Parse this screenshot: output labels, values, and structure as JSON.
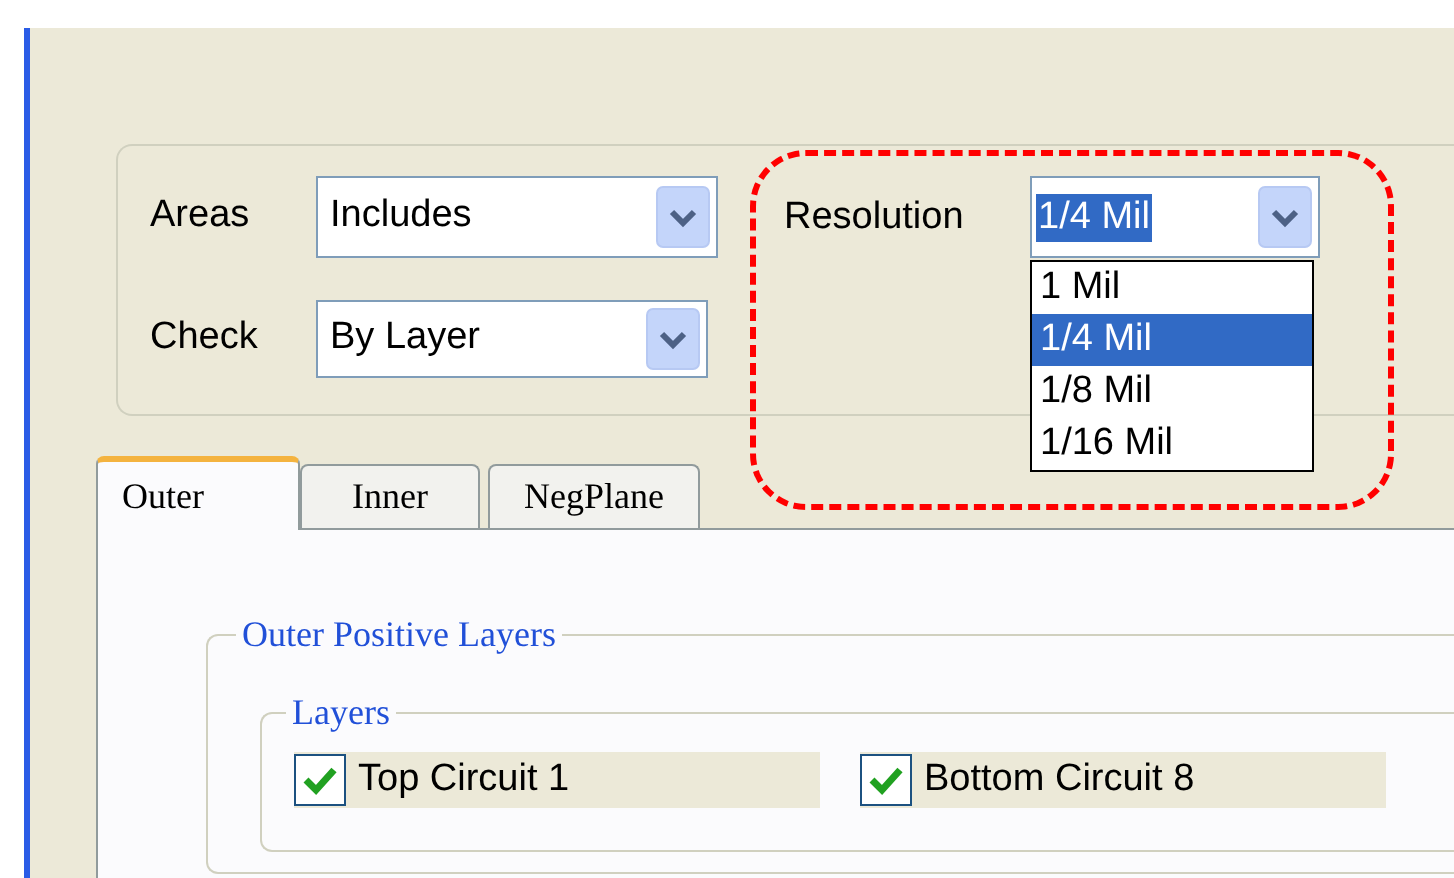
{
  "filters": [
    {
      "label": "Areas",
      "value": "Includes"
    },
    {
      "label": "Check",
      "value": "By Layer"
    }
  ],
  "resolution": {
    "label": "Resolution",
    "value": "1/4 Mil",
    "options": [
      {
        "label": "1 Mil",
        "selected": false
      },
      {
        "label": "1/4 Mil",
        "selected": true
      },
      {
        "label": "1/8 Mil",
        "selected": false
      },
      {
        "label": "1/16 Mil",
        "selected": false
      }
    ]
  },
  "tabs": [
    {
      "label": "Outer",
      "selected": true
    },
    {
      "label": "Inner",
      "selected": false
    },
    {
      "label": "NegPlane",
      "selected": false
    }
  ],
  "group": {
    "title": "Outer Positive Layers",
    "subgroup": {
      "title": "Layers",
      "items": [
        {
          "label": "Top Circuit 1",
          "checked": true
        },
        {
          "label": "Bottom Circuit 8",
          "checked": true
        }
      ]
    }
  }
}
